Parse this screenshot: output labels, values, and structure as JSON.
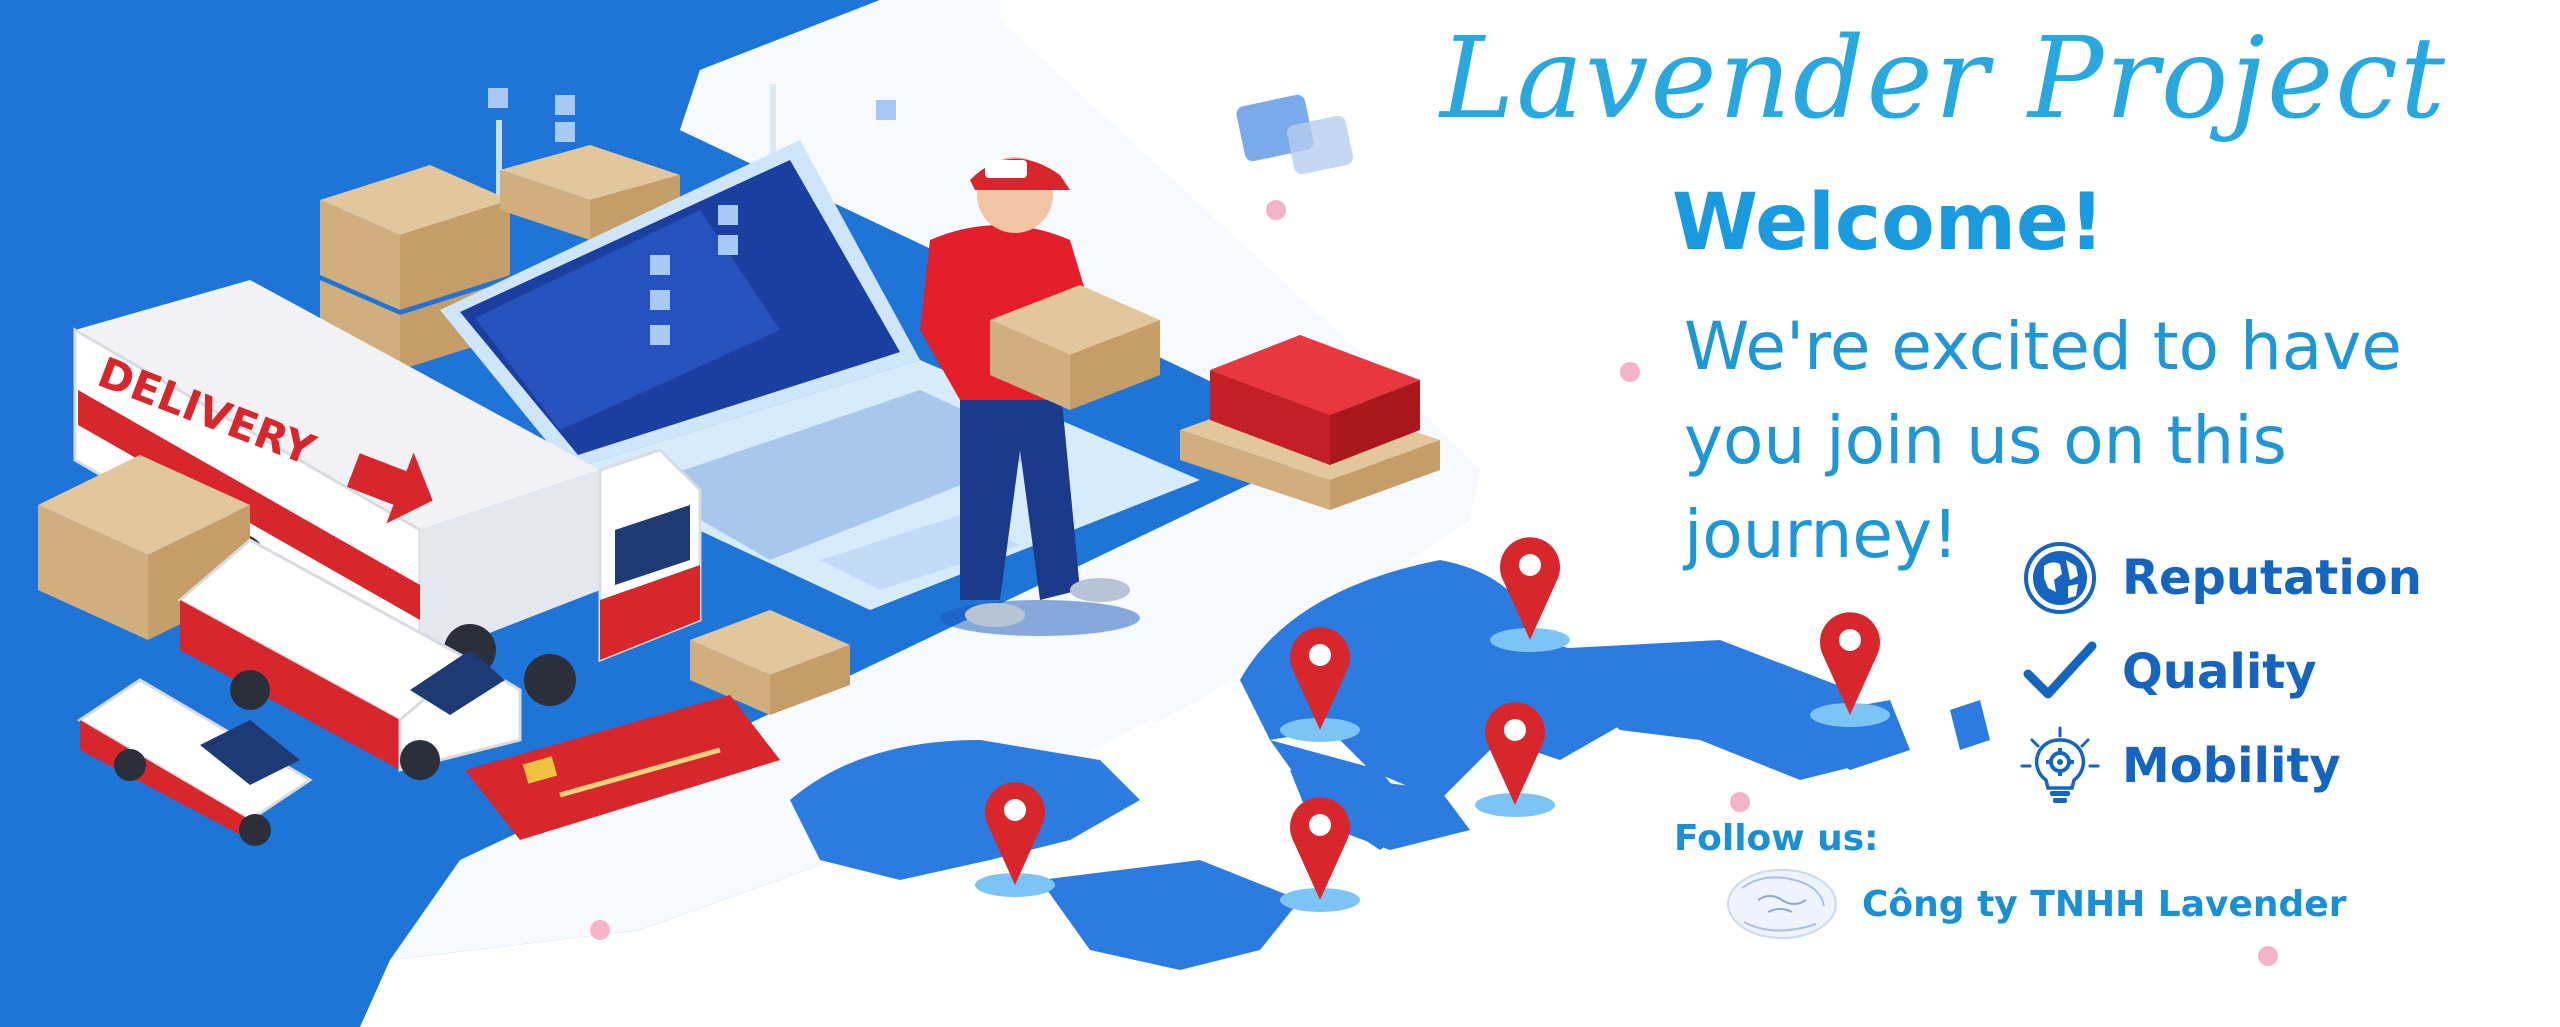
{
  "banner": {
    "brand_title": "Lavender Project",
    "welcome": "Welcome!",
    "tagline_lines": [
      "We're excited to have",
      "you join us on this",
      "journey!"
    ],
    "features": [
      {
        "label": "Reputation",
        "icon": "globe-icon"
      },
      {
        "label": "Quality",
        "icon": "checkmark-icon"
      },
      {
        "label": "Mobility",
        "icon": "lightbulb-gear-icon"
      }
    ],
    "follow_label": "Follow us:",
    "company_name": "Công ty TNHH Lavender",
    "illustration": {
      "truck_label": "DELIVERY"
    }
  },
  "colors": {
    "brand_blue": "#1a9be0",
    "feature_blue": "#1565c0",
    "background_blue": "#1e73d8",
    "accent_red": "#d7262c",
    "map_blue": "#2c7be0"
  }
}
